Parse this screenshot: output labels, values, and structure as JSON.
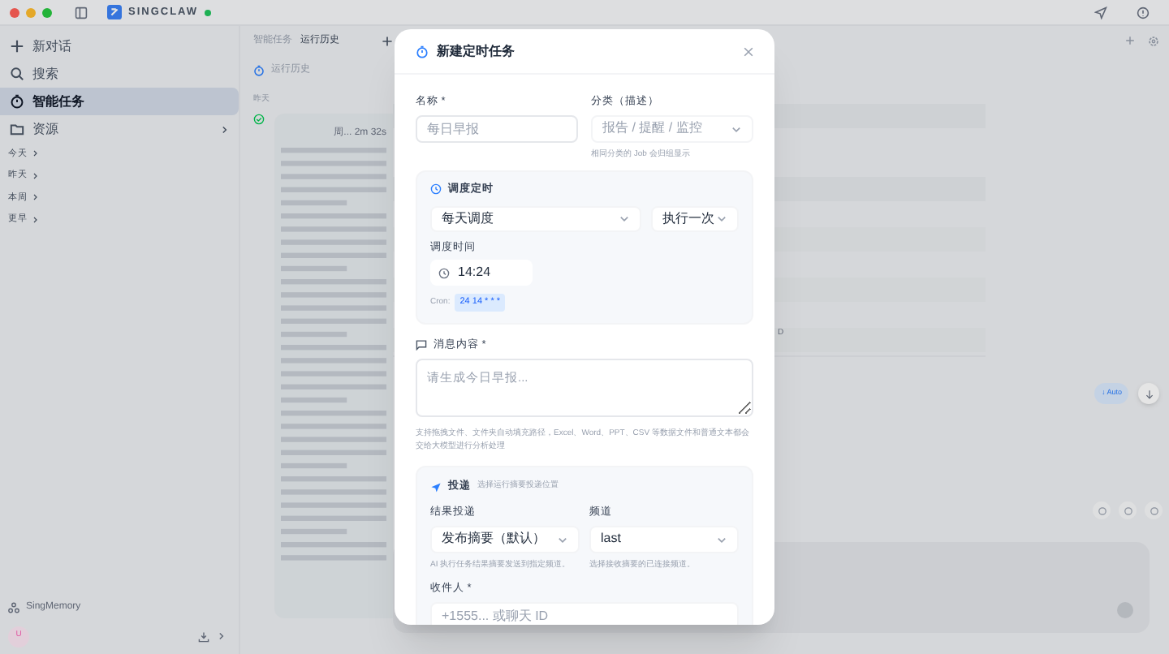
{
  "titlebar": {
    "app_name": "SINGCLAW"
  },
  "sidebar": {
    "items": [
      {
        "label": "新对话",
        "kind": "plus",
        "selected": false
      },
      {
        "label": "搜索",
        "kind": "search",
        "selected": false
      },
      {
        "label": "智能任务",
        "kind": "timer",
        "selected": true
      },
      {
        "label": "资源",
        "kind": "folder",
        "selected": false
      }
    ],
    "groups": [
      "今天",
      "昨天",
      "本周",
      "更早"
    ],
    "memory": "SingMemory",
    "avatar": "U"
  },
  "task_panel": {
    "breadcrumb": "智能任务",
    "title": "运行历史",
    "history_link": "运行历史",
    "day": "昨天",
    "meta": "周...  2m 32s"
  },
  "right_panel": {
    "auto_label": "↓ Auto",
    "side_letter": "D"
  },
  "modal": {
    "title": "新建定时任务",
    "name_label": "名称 *",
    "name_placeholder": "每日早报",
    "category_label": "分类（描述）",
    "category_placeholder": "报告 / 提醒 / 监控",
    "category_hint": "相同分类的 Job 会归组显示",
    "schedule": {
      "title": "调度定时",
      "frequency": "每天调度",
      "repeat": "执行一次",
      "time_label": "调度时间",
      "time": "14:24",
      "cron_label": "Cron:",
      "cron": "24 14 * * *"
    },
    "message_label": "消息内容 *",
    "message_placeholder": "请生成今日早报...",
    "message_hint": "支持拖拽文件、文件夹自动填充路径，Excel、Word、PPT、CSV 等数据文件和普通文本都会交给大模型进行分析处理",
    "delivery": {
      "title": "投递",
      "subtitle": "选择运行摘要投递位置",
      "result_label": "结果投递",
      "result_value": "发布摘要（默认）",
      "result_hint": "AI 执行任务结果摘要发送到指定频道。",
      "channel_label": "频道",
      "channel_value": "last",
      "channel_hint": "选择接收摘要的已连接频道。",
      "recipient_label": "收件人 *",
      "recipient_placeholder": "+1555... 或聊天 ID"
    }
  }
}
